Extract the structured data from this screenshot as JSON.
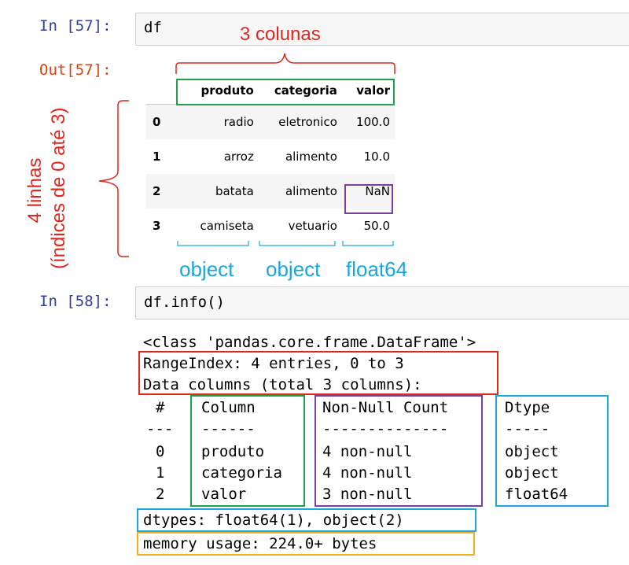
{
  "cell57": {
    "in_prompt": "In [57]:",
    "code": "df",
    "out_prompt": "Out[57]:"
  },
  "dataframe": {
    "columns": [
      "produto",
      "categoria",
      "valor"
    ],
    "rows": [
      {
        "index": "0",
        "produto": "radio",
        "categoria": "eletronico",
        "valor": "100.0"
      },
      {
        "index": "1",
        "produto": "arroz",
        "categoria": "alimento",
        "valor": "10.0"
      },
      {
        "index": "2",
        "produto": "batata",
        "categoria": "alimento",
        "valor": "NaN"
      },
      {
        "index": "3",
        "produto": "camiseta",
        "categoria": "vetuario",
        "valor": "50.0"
      }
    ]
  },
  "annotations": {
    "columns_label": "3 colunas",
    "rows_label_1": "4 linhas",
    "rows_label_2": "(índices de 0 até 3)",
    "dtype_produto": "object",
    "dtype_categoria": "object",
    "dtype_valor": "float64",
    "colors": {
      "red": "#e0271e",
      "green": "#1fa24a",
      "purple": "#7b3fa0",
      "blue": "#1aa6e0",
      "orange": "#f2b21c"
    }
  },
  "cell58": {
    "in_prompt": "In [58]:",
    "code": "df.info()",
    "output": {
      "class_line": "<class 'pandas.core.frame.DataFrame'>",
      "range_index": "RangeIndex: 4 entries, 0 to 3",
      "data_columns": "Data columns (total 3 columns):",
      "header": {
        "num": "#",
        "column": "Column",
        "non_null": "Non-Null Count",
        "dtype": "Dtype"
      },
      "separator": {
        "num": "---",
        "column": "------",
        "non_null": "--------------",
        "dtype": "-----"
      },
      "rows": [
        {
          "num": "0",
          "column": "produto",
          "non_null": "4 non-null",
          "dtype": "object"
        },
        {
          "num": "1",
          "column": "categoria",
          "non_null": "4 non-null",
          "dtype": "object"
        },
        {
          "num": "2",
          "column": "valor",
          "non_null": "3 non-null",
          "dtype": "float64"
        }
      ],
      "dtypes_line": "dtypes: float64(1), object(2)",
      "memory_line": "memory usage: 224.0+ bytes"
    }
  }
}
